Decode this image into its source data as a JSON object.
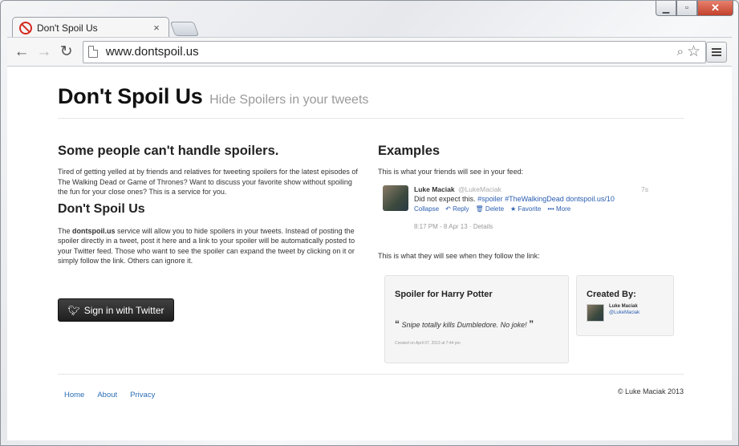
{
  "browser": {
    "tab_title": "Don't Spoil Us",
    "tab_close": "×",
    "url": "www.dontspoil.us"
  },
  "hero": {
    "title": "Don't Spoil Us",
    "tagline": "Hide Spoilers in your tweets"
  },
  "intro": {
    "heading": "Some people can't handle spoilers.",
    "body": "Tired of getting yelled at by friends and relatives for tweeting spoilers for the latest episodes of The Walking Dead or Game of Thrones? Want to discuss your favorite show without spoiling the fun for your close ones? This is a service for you."
  },
  "about": {
    "heading": "Don't Spoil Us",
    "body_prefix": "The ",
    "body_brand": "dontspoil.us",
    "body_rest": " service will allow you to hide spoilers in your tweets. Instead of posting the spoiler directly in a tweet, post it here and a link to your spoiler will be automatically posted to your Twitter feed. Those who want to see the spoiler can expand the tweet by clicking on it or simply follow the link. Others can ignore it."
  },
  "signin": {
    "label": "Sign in with Twitter"
  },
  "examples": {
    "heading": "Examples",
    "feed_caption": "This is what your friends will see in your feed:",
    "link_caption": "This is what they will see when they follow the link:",
    "tweet": {
      "name": "Luke Maciak",
      "handle": "@LukeMaciak",
      "time": "7s",
      "text": "Did not expect this.",
      "tags": "#spoiler #TheWalkingDead dontspoil.us/10",
      "actions": [
        "Collapse",
        "Reply",
        "Delete",
        "Favorite",
        "More"
      ],
      "meta": "8:17 PM - 8 Apr 13 · Details"
    },
    "spoiler_card": {
      "title": "Spoiler for Harry Potter",
      "quote": "Snipe totally kills Dumbledore. No joke!",
      "date": "Created on April 07, 2013 at 7:44 pm"
    },
    "created_card": {
      "title": "Created By:",
      "name": "Luke Maciak",
      "handle": "@LukeMaciak"
    }
  },
  "footer": {
    "links": [
      "Home",
      "About",
      "Privacy"
    ],
    "copyright": "© Luke Maciak 2013"
  }
}
